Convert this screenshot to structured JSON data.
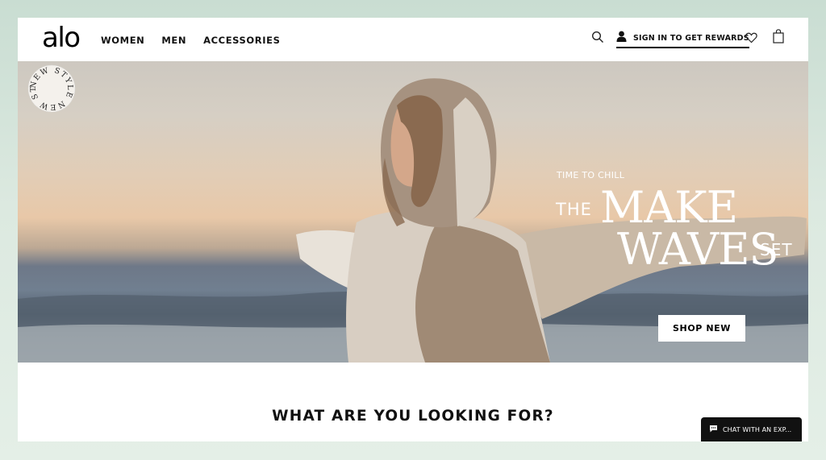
{
  "brand": {
    "logo": "alo"
  },
  "nav": {
    "items": [
      "WOMEN",
      "MEN",
      "ACCESSORIES"
    ]
  },
  "header": {
    "signin_label": "SIGN IN TO GET REWARDS",
    "icons": [
      "search-icon",
      "user-icon",
      "heart-icon",
      "shopping-bag-icon"
    ]
  },
  "hero": {
    "badge_text": "NEW STYLE NEW STYLE",
    "kicker": "TIME TO CHILL",
    "the": "THE",
    "make": "MAKE",
    "waves": "WAVES",
    "set": "SET",
    "cta": "SHOP NEW"
  },
  "section": {
    "title": "WHAT ARE YOU LOOKING FOR?"
  },
  "chat": {
    "label": "CHAT WITH AN EXP..."
  },
  "colors": {
    "accent": "#000000",
    "background": "#dce9e0"
  }
}
